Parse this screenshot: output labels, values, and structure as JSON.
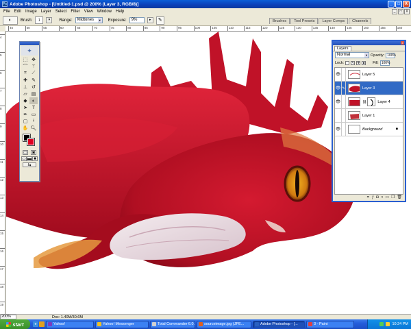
{
  "window": {
    "title": "Adobe Photoshop - [Untitled-1.psd @ 200% (Layer 3, RGB/8)]",
    "controls": [
      "_",
      "□",
      "X"
    ]
  },
  "menu": [
    "File",
    "Edit",
    "Image",
    "Layer",
    "Select",
    "Filter",
    "View",
    "Window",
    "Help"
  ],
  "options": {
    "brush_label": "Brush:",
    "brush_size": "1",
    "range_label": "Range:",
    "range_value": "Midtones",
    "exposure_label": "Exposure:",
    "exposure_value": "9%"
  },
  "palette_well": [
    "Brushes",
    "Tool Presets",
    "Layer Comps",
    "Channels"
  ],
  "ruler": {
    "top": [
      "45",
      "50",
      "55",
      "60",
      "65",
      "70",
      "75",
      "80",
      "85",
      "90",
      "95",
      "100",
      "105",
      "110",
      "115",
      "120",
      "125",
      "130",
      "135",
      "140",
      "145",
      "150",
      "155",
      "160"
    ],
    "left": [
      "4",
      "5",
      "6",
      "7",
      "8",
      "9",
      "10",
      "11",
      "12",
      "13",
      "14",
      "15",
      "16",
      "17",
      "18",
      "19"
    ]
  },
  "layers_panel": {
    "tab": "Layers",
    "blend_mode": "Normal",
    "opacity_label": "Opacity:",
    "opacity_value": "100%",
    "lock_label": "Lock:",
    "fill_label": "Fill:",
    "fill_value": "100%",
    "layers": [
      {
        "name": "Layer 5",
        "visible": true,
        "selected": false
      },
      {
        "name": "Layer 3",
        "visible": true,
        "selected": true
      },
      {
        "name": "Layer 4",
        "visible": true,
        "selected": false
      },
      {
        "name": "Layer 1",
        "visible": false,
        "selected": false
      },
      {
        "name": "Background",
        "visible": true,
        "selected": false
      }
    ]
  },
  "status": {
    "zoom": "200%",
    "doc": "Doc: 1.40M/30.6M"
  },
  "taskbar": {
    "start": "start",
    "buttons": [
      {
        "label": "Yahoo!",
        "color": "#7a3cc0",
        "active": false
      },
      {
        "label": "Yahoo! Messenger",
        "color": "#f0c020",
        "active": false
      },
      {
        "label": "Total Commander 6.0...",
        "color": "#d0d0d0",
        "active": false
      },
      {
        "label": "sourceimage.jpg (JPE...",
        "color": "#e06020",
        "active": false
      },
      {
        "label": "Adobe Photoshop - [...",
        "color": "#2a60c0",
        "active": true
      },
      {
        "label": "3 - Paint",
        "color": "#e04040",
        "active": false
      }
    ],
    "clock": "10:24 PM"
  },
  "colors": {
    "foreground": "#000000",
    "background": "#e00020",
    "selection": "#316ac5",
    "rooster_red": "#c8102e"
  }
}
